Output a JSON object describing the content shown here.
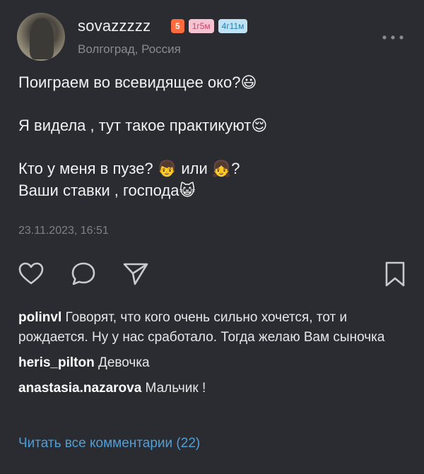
{
  "author": {
    "username": "sovazzzzz",
    "badge_level": "5",
    "badge_age": "1г5м",
    "badge_time": "4г11м",
    "location": "Волгоград, Россия"
  },
  "post": {
    "line1": "Поиграем во всевидящее око?",
    "line1_emoji": "😃",
    "line2": "Я видела , тут такое практикуют",
    "line2_emoji": "😌",
    "line3_a": "Кто у меня в пузе?",
    "line3_emoji_boy": "👦",
    "line3_b": "или",
    "line3_emoji_girl": "👧",
    "line3_c": "?",
    "line4": "Ваши ставки , господа",
    "line4_emoji": "😺",
    "timestamp": "23.11.2023, 16:51"
  },
  "icons": [
    "more-icon",
    "heart-icon",
    "comment-icon",
    "share-icon",
    "bookmark-icon"
  ],
  "comments": [
    {
      "user": "polinvl",
      "text": "Говорят, что кого очень сильно хочется, тот и рождается. Ну у нас сработало. Тогда желаю Вам сыночка"
    },
    {
      "user": "heris_pilton",
      "text": "Девочка"
    },
    {
      "user": "anastasia.nazarova",
      "text": "Мальчик !"
    }
  ],
  "all_comments_link": "Читать все комментарии (22)",
  "colors": {
    "background": "#2b2c32",
    "link": "#4f9fd6",
    "badge_level": "#ff6b3d",
    "badge_age": "#f4c2d0",
    "badge_time": "#bfe3f5"
  }
}
